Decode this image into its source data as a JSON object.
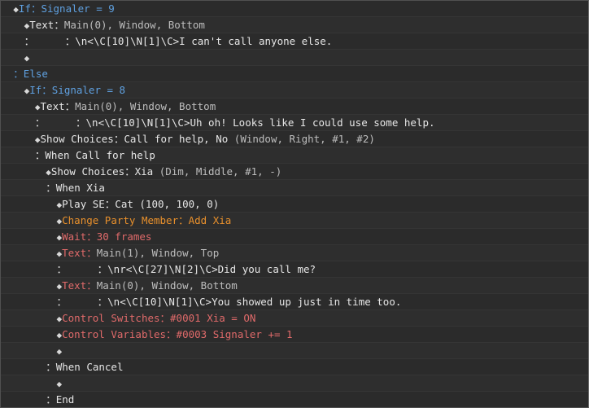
{
  "colors": {
    "background": "#2b2b2b",
    "white": "#e6e6e6",
    "flow_blue": "#5fa0e0",
    "party_orange": "#e8902c",
    "system_red": "#e06a6a",
    "param_gray": "#bdbdbd"
  },
  "event_commands": [
    {
      "name": "if-command",
      "indent": 1,
      "parts": [
        {
          "t": "◆",
          "c": "diamond"
        },
        {
          "t": "If：Signaler = 9",
          "c": "c-blue"
        }
      ]
    },
    {
      "name": "text-command",
      "indent": 2,
      "parts": [
        {
          "t": "◆",
          "c": "diamond"
        },
        {
          "t": "Text：",
          "c": "c-white"
        },
        {
          "t": "Main(0), Window, Bottom",
          "c": "c-gray"
        }
      ]
    },
    {
      "name": "text-line",
      "indent": 2,
      "parts": [
        {
          "t": "：",
          "c": "c-white"
        },
        {
          "t": "     ：\\n<\\C[10]\\N[1]\\C>I can't call anyone else.",
          "c": "c-white"
        }
      ]
    },
    {
      "name": "empty-command",
      "indent": 2,
      "parts": [
        {
          "t": "◆",
          "c": "diamond"
        }
      ]
    },
    {
      "name": "else-branch",
      "indent": 1,
      "parts": [
        {
          "t": "：Else",
          "c": "c-blue"
        }
      ]
    },
    {
      "name": "if-command",
      "indent": 2,
      "parts": [
        {
          "t": "◆",
          "c": "diamond"
        },
        {
          "t": "If：Signaler = 8",
          "c": "c-blue"
        }
      ]
    },
    {
      "name": "text-command",
      "indent": 3,
      "parts": [
        {
          "t": "◆",
          "c": "diamond"
        },
        {
          "t": "Text：",
          "c": "c-white"
        },
        {
          "t": "Main(0), Window, Bottom",
          "c": "c-gray"
        }
      ]
    },
    {
      "name": "text-line",
      "indent": 3,
      "parts": [
        {
          "t": "：",
          "c": "c-white"
        },
        {
          "t": "     ：\\n<\\C[10]\\N[1]\\C>Uh oh! Looks like I could use some help.",
          "c": "c-white"
        }
      ]
    },
    {
      "name": "show-choices-command",
      "indent": 3,
      "parts": [
        {
          "t": "◆",
          "c": "diamond"
        },
        {
          "t": "Show Choices：Call for help, No ",
          "c": "c-white"
        },
        {
          "t": "(Window, Right, #1, #2)",
          "c": "c-gray"
        }
      ]
    },
    {
      "name": "when-branch",
      "indent": 3,
      "parts": [
        {
          "t": "：When Call for help",
          "c": "c-white"
        }
      ]
    },
    {
      "name": "show-choices-command",
      "indent": 4,
      "parts": [
        {
          "t": "◆",
          "c": "diamond"
        },
        {
          "t": "Show Choices：Xia ",
          "c": "c-white"
        },
        {
          "t": "(Dim, Middle, #1, -)",
          "c": "c-gray"
        }
      ]
    },
    {
      "name": "when-branch",
      "indent": 4,
      "parts": [
        {
          "t": "：When Xia",
          "c": "c-white"
        }
      ]
    },
    {
      "name": "play-se-command",
      "indent": 5,
      "parts": [
        {
          "t": "◆",
          "c": "diamond"
        },
        {
          "t": "Play SE：Cat (100, 100, 0)",
          "c": "c-white"
        }
      ]
    },
    {
      "name": "change-party-member-command",
      "indent": 5,
      "parts": [
        {
          "t": "◆",
          "c": "diamond"
        },
        {
          "t": "Change Party Member：Add Xia",
          "c": "c-orange"
        }
      ]
    },
    {
      "name": "wait-command",
      "indent": 5,
      "parts": [
        {
          "t": "◆",
          "c": "diamond"
        },
        {
          "t": "Wait：30 frames",
          "c": "c-red"
        }
      ]
    },
    {
      "name": "text-command",
      "indent": 5,
      "parts": [
        {
          "t": "◆",
          "c": "diamond"
        },
        {
          "t": "Text：",
          "c": "c-red"
        },
        {
          "t": "Main(1), Window, Top",
          "c": "c-gray"
        }
      ]
    },
    {
      "name": "text-line",
      "indent": 5,
      "parts": [
        {
          "t": "：",
          "c": "c-white"
        },
        {
          "t": "     ：\\nr<\\C[27]\\N[2]\\C>Did you call me?",
          "c": "c-white"
        }
      ]
    },
    {
      "name": "text-command",
      "indent": 5,
      "parts": [
        {
          "t": "◆",
          "c": "diamond"
        },
        {
          "t": "Text：",
          "c": "c-red"
        },
        {
          "t": "Main(0), Window, Bottom",
          "c": "c-gray"
        }
      ]
    },
    {
      "name": "text-line",
      "indent": 5,
      "parts": [
        {
          "t": "：",
          "c": "c-white"
        },
        {
          "t": "     ：\\n<\\C[10]\\N[1]\\C>You showed up just in time too.",
          "c": "c-white"
        }
      ]
    },
    {
      "name": "control-switches-command",
      "indent": 5,
      "parts": [
        {
          "t": "◆",
          "c": "diamond"
        },
        {
          "t": "Control Switches：#0001 Xia = ON",
          "c": "c-red"
        }
      ]
    },
    {
      "name": "control-variables-command",
      "indent": 5,
      "parts": [
        {
          "t": "◆",
          "c": "diamond"
        },
        {
          "t": "Control Variables：#0003 Signaler += 1",
          "c": "c-red"
        }
      ]
    },
    {
      "name": "empty-command",
      "indent": 5,
      "parts": [
        {
          "t": "◆",
          "c": "diamond"
        }
      ]
    },
    {
      "name": "when-cancel-branch",
      "indent": 4,
      "parts": [
        {
          "t": "：When Cancel",
          "c": "c-white"
        }
      ]
    },
    {
      "name": "empty-command",
      "indent": 5,
      "parts": [
        {
          "t": "◆",
          "c": "diamond"
        }
      ]
    },
    {
      "name": "end-branch",
      "indent": 4,
      "parts": [
        {
          "t": "：End",
          "c": "c-white"
        }
      ]
    }
  ]
}
